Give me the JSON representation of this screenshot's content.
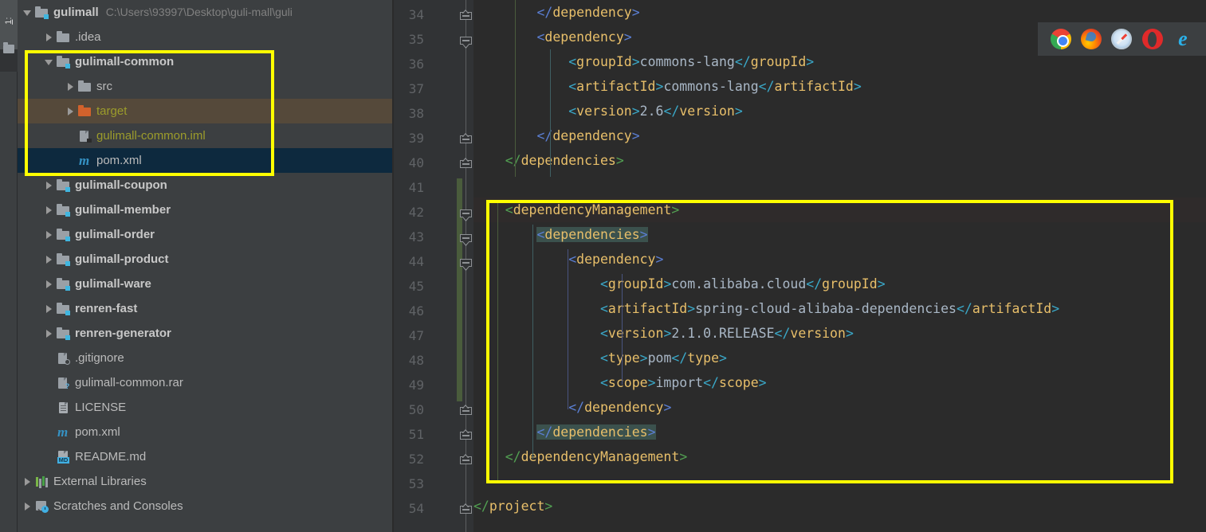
{
  "toolwindow": {
    "tab_label": "1: Project",
    "tab_number": "1",
    "tab_name": "Pro"
  },
  "project_tree": {
    "rows": [
      {
        "indent": 0,
        "arrow": "down",
        "icon": "module-folder-icon",
        "label": "gulimall",
        "style": "bold",
        "path": "C:\\Users\\93997\\Desktop\\guli-mall\\guli",
        "selected": "none"
      },
      {
        "indent": 1,
        "arrow": "right",
        "icon": "folder-icon",
        "label": ".idea",
        "style": "plain",
        "path": "",
        "selected": "none"
      },
      {
        "indent": 1,
        "arrow": "down",
        "icon": "module-folder-icon",
        "label": "gulimall-common",
        "style": "bold",
        "path": "",
        "selected": "none"
      },
      {
        "indent": 2,
        "arrow": "right",
        "icon": "folder-icon",
        "label": "src",
        "style": "plain",
        "path": "",
        "selected": "none"
      },
      {
        "indent": 2,
        "arrow": "right",
        "icon": "folder-orange-icon",
        "label": "target",
        "style": "olive",
        "path": "",
        "selected": "brown"
      },
      {
        "indent": 2,
        "arrow": "none",
        "icon": "iml-file-icon",
        "label": "gulimall-common.iml",
        "style": "olive",
        "path": "",
        "selected": "none"
      },
      {
        "indent": 2,
        "arrow": "none",
        "icon": "maven-m-icon",
        "label": "pom.xml",
        "style": "plain",
        "path": "",
        "selected": "blue"
      },
      {
        "indent": 1,
        "arrow": "right",
        "icon": "module-folder-icon",
        "label": "gulimall-coupon",
        "style": "bold",
        "path": "",
        "selected": "none"
      },
      {
        "indent": 1,
        "arrow": "right",
        "icon": "module-folder-icon",
        "label": "gulimall-member",
        "style": "bold",
        "path": "",
        "selected": "none"
      },
      {
        "indent": 1,
        "arrow": "right",
        "icon": "module-folder-icon",
        "label": "gulimall-order",
        "style": "bold",
        "path": "",
        "selected": "none"
      },
      {
        "indent": 1,
        "arrow": "right",
        "icon": "module-folder-icon",
        "label": "gulimall-product",
        "style": "bold",
        "path": "",
        "selected": "none"
      },
      {
        "indent": 1,
        "arrow": "right",
        "icon": "module-folder-icon",
        "label": "gulimall-ware",
        "style": "bold",
        "path": "",
        "selected": "none"
      },
      {
        "indent": 1,
        "arrow": "right",
        "icon": "module-folder-icon",
        "label": "renren-fast",
        "style": "bold",
        "path": "",
        "selected": "none"
      },
      {
        "indent": 1,
        "arrow": "right",
        "icon": "module-folder-icon",
        "label": "renren-generator",
        "style": "bold",
        "path": "",
        "selected": "none"
      },
      {
        "indent": 1,
        "arrow": "none",
        "icon": "gitignore-file-icon",
        "label": ".gitignore",
        "style": "plain",
        "path": "",
        "selected": "none"
      },
      {
        "indent": 1,
        "arrow": "none",
        "icon": "unknown-file-icon",
        "label": "gulimall-common.rar",
        "style": "plain",
        "path": "",
        "selected": "none"
      },
      {
        "indent": 1,
        "arrow": "none",
        "icon": "text-file-icon",
        "label": "LICENSE",
        "style": "plain",
        "path": "",
        "selected": "none"
      },
      {
        "indent": 1,
        "arrow": "none",
        "icon": "maven-m-icon",
        "label": "pom.xml",
        "style": "plain",
        "path": "",
        "selected": "none"
      },
      {
        "indent": 1,
        "arrow": "none",
        "icon": "markdown-file-icon",
        "label": "README.md",
        "style": "plain",
        "path": "",
        "selected": "none"
      },
      {
        "indent": 0,
        "arrow": "right",
        "icon": "external-libraries-icon",
        "label": "External Libraries",
        "style": "plain",
        "path": "",
        "selected": "none"
      },
      {
        "indent": 0,
        "arrow": "right",
        "icon": "scratches-icon",
        "label": "Scratches and Consoles",
        "style": "plain",
        "path": "",
        "selected": "none"
      }
    ]
  },
  "editor": {
    "first_line_number": 34,
    "line_numbers": [
      34,
      35,
      36,
      37,
      38,
      39,
      40,
      41,
      42,
      43,
      44,
      45,
      46,
      47,
      48,
      49,
      50,
      51,
      52,
      53,
      54
    ],
    "lines": [
      {
        "n": 34,
        "indent": 8,
        "parts": [
          {
            "t": "</",
            "c": "br-blue"
          },
          {
            "t": "dependency",
            "c": "tag"
          },
          {
            "t": ">",
            "c": "br-blue"
          }
        ],
        "fold": "open",
        "alt": false
      },
      {
        "n": 35,
        "indent": 8,
        "parts": [
          {
            "t": "<",
            "c": "br-blue"
          },
          {
            "t": "dependency",
            "c": "tag"
          },
          {
            "t": ">",
            "c": "br-blue"
          }
        ],
        "fold": "expanded",
        "alt": false
      },
      {
        "n": 36,
        "indent": 12,
        "parts": [
          {
            "t": "<",
            "c": "br-cyan"
          },
          {
            "t": "groupId",
            "c": "tag"
          },
          {
            "t": ">",
            "c": "br-cyan"
          },
          {
            "t": "commons-lang",
            "c": "txt"
          },
          {
            "t": "</",
            "c": "br-cyan"
          },
          {
            "t": "groupId",
            "c": "tag"
          },
          {
            "t": ">",
            "c": "br-cyan"
          }
        ],
        "fold": "",
        "alt": false
      },
      {
        "n": 37,
        "indent": 12,
        "parts": [
          {
            "t": "<",
            "c": "br-cyan"
          },
          {
            "t": "artifactId",
            "c": "tag"
          },
          {
            "t": ">",
            "c": "br-cyan"
          },
          {
            "t": "commons-lang",
            "c": "txt"
          },
          {
            "t": "</",
            "c": "br-cyan"
          },
          {
            "t": "artifactId",
            "c": "tag"
          },
          {
            "t": ">",
            "c": "br-cyan"
          }
        ],
        "fold": "",
        "alt": false
      },
      {
        "n": 38,
        "indent": 12,
        "parts": [
          {
            "t": "<",
            "c": "br-cyan"
          },
          {
            "t": "version",
            "c": "tag"
          },
          {
            "t": ">",
            "c": "br-cyan"
          },
          {
            "t": "2.6",
            "c": "txt"
          },
          {
            "t": "</",
            "c": "br-cyan"
          },
          {
            "t": "version",
            "c": "tag"
          },
          {
            "t": ">",
            "c": "br-cyan"
          }
        ],
        "fold": "",
        "alt": false
      },
      {
        "n": 39,
        "indent": 8,
        "parts": [
          {
            "t": "</",
            "c": "br-blue"
          },
          {
            "t": "dependency",
            "c": "tag"
          },
          {
            "t": ">",
            "c": "br-blue"
          }
        ],
        "fold": "open",
        "alt": false
      },
      {
        "n": 40,
        "indent": 4,
        "parts": [
          {
            "t": "</",
            "c": "br-green"
          },
          {
            "t": "dependencies",
            "c": "tag"
          },
          {
            "t": ">",
            "c": "br-green"
          }
        ],
        "fold": "open",
        "alt": false
      },
      {
        "n": 41,
        "indent": 0,
        "parts": [],
        "fold": "",
        "alt": false
      },
      {
        "n": 42,
        "indent": 4,
        "parts": [
          {
            "t": "<",
            "c": "br-green"
          },
          {
            "t": "dependencyManagement",
            "c": "tag"
          },
          {
            "t": ">",
            "c": "br-green"
          }
        ],
        "fold": "expanded",
        "alt": true
      },
      {
        "n": 43,
        "indent": 8,
        "parts": [
          {
            "t": "<",
            "c": "br-blue hl"
          },
          {
            "t": "dependencies",
            "c": "tag hl"
          },
          {
            "t": ">",
            "c": "br-blue hl"
          }
        ],
        "fold": "expanded",
        "alt": false
      },
      {
        "n": 44,
        "indent": 12,
        "parts": [
          {
            "t": "<",
            "c": "br-blue"
          },
          {
            "t": "dependency",
            "c": "tag"
          },
          {
            "t": ">",
            "c": "br-blue"
          }
        ],
        "fold": "expanded",
        "alt": false
      },
      {
        "n": 45,
        "indent": 16,
        "parts": [
          {
            "t": "<",
            "c": "br-cyan"
          },
          {
            "t": "groupId",
            "c": "tag"
          },
          {
            "t": ">",
            "c": "br-cyan"
          },
          {
            "t": "com.alibaba.cloud",
            "c": "txt"
          },
          {
            "t": "</",
            "c": "br-cyan"
          },
          {
            "t": "groupId",
            "c": "tag"
          },
          {
            "t": ">",
            "c": "br-cyan"
          }
        ],
        "fold": "",
        "alt": false
      },
      {
        "n": 46,
        "indent": 16,
        "parts": [
          {
            "t": "<",
            "c": "br-cyan"
          },
          {
            "t": "artifactId",
            "c": "tag"
          },
          {
            "t": ">",
            "c": "br-cyan"
          },
          {
            "t": "spring-cloud-alibaba-dependencies",
            "c": "txt"
          },
          {
            "t": "</",
            "c": "br-cyan"
          },
          {
            "t": "artifactId",
            "c": "tag"
          },
          {
            "t": ">",
            "c": "br-cyan"
          }
        ],
        "fold": "",
        "alt": false
      },
      {
        "n": 47,
        "indent": 16,
        "parts": [
          {
            "t": "<",
            "c": "br-cyan"
          },
          {
            "t": "version",
            "c": "tag"
          },
          {
            "t": ">",
            "c": "br-cyan"
          },
          {
            "t": "2.1.0.RELEASE",
            "c": "txt"
          },
          {
            "t": "</",
            "c": "br-cyan"
          },
          {
            "t": "version",
            "c": "tag"
          },
          {
            "t": ">",
            "c": "br-cyan"
          }
        ],
        "fold": "",
        "alt": false
      },
      {
        "n": 48,
        "indent": 16,
        "parts": [
          {
            "t": "<",
            "c": "br-cyan"
          },
          {
            "t": "type",
            "c": "tag"
          },
          {
            "t": ">",
            "c": "br-cyan"
          },
          {
            "t": "pom",
            "c": "txt"
          },
          {
            "t": "</",
            "c": "br-cyan"
          },
          {
            "t": "type",
            "c": "tag"
          },
          {
            "t": ">",
            "c": "br-cyan"
          }
        ],
        "fold": "",
        "alt": false
      },
      {
        "n": 49,
        "indent": 16,
        "parts": [
          {
            "t": "<",
            "c": "br-cyan"
          },
          {
            "t": "scope",
            "c": "tag"
          },
          {
            "t": ">",
            "c": "br-cyan"
          },
          {
            "t": "import",
            "c": "txt"
          },
          {
            "t": "</",
            "c": "br-cyan"
          },
          {
            "t": "scope",
            "c": "tag"
          },
          {
            "t": ">",
            "c": "br-cyan"
          }
        ],
        "fold": "",
        "alt": false
      },
      {
        "n": 50,
        "indent": 12,
        "parts": [
          {
            "t": "</",
            "c": "br-blue"
          },
          {
            "t": "dependency",
            "c": "tag"
          },
          {
            "t": ">",
            "c": "br-blue"
          }
        ],
        "fold": "open",
        "alt": false
      },
      {
        "n": 51,
        "indent": 8,
        "parts": [
          {
            "t": "</",
            "c": "br-blue hl"
          },
          {
            "t": "dependencies",
            "c": "tag hl"
          },
          {
            "t": ">",
            "c": "br-blue hl"
          }
        ],
        "fold": "open",
        "alt": false
      },
      {
        "n": 52,
        "indent": 4,
        "parts": [
          {
            "t": "</",
            "c": "br-green"
          },
          {
            "t": "dependencyManagement",
            "c": "tag"
          },
          {
            "t": ">",
            "c": "br-green"
          }
        ],
        "fold": "open",
        "alt": false
      },
      {
        "n": 53,
        "indent": 0,
        "parts": [],
        "fold": "",
        "alt": false
      },
      {
        "n": 54,
        "indent": 0,
        "parts": [
          {
            "t": "</",
            "c": "br-green"
          },
          {
            "t": "project",
            "c": "tag"
          },
          {
            "t": ">",
            "c": "br-green"
          }
        ],
        "fold": "open",
        "alt": false
      }
    ]
  },
  "browser_bar": {
    "icons": [
      "chrome-icon",
      "firefox-icon",
      "safari-icon",
      "opera-icon",
      "internet-explorer-icon"
    ],
    "ie_glyph": "e"
  },
  "annotations": {
    "tree_box_label": "gulimall-common module highlight",
    "code_box_label": "dependencyManagement block highlight"
  },
  "colors": {
    "accent_yellow": "#ffff00",
    "selection_blue": "#0d293e",
    "hover_brown": "#55493a",
    "editor_bg": "#2b2b2b",
    "panel_bg": "#3c3f41",
    "gutter_bg": "#313335",
    "tag_name": "#e8bf6a",
    "text_value": "#a9b7c6",
    "bracket_green": "#52a052",
    "bracket_blue": "#5b7fd4",
    "bracket_cyan": "#3aa8c8",
    "match_highlight": "#3b514d",
    "change_bar_green": "#4a5c3c"
  }
}
